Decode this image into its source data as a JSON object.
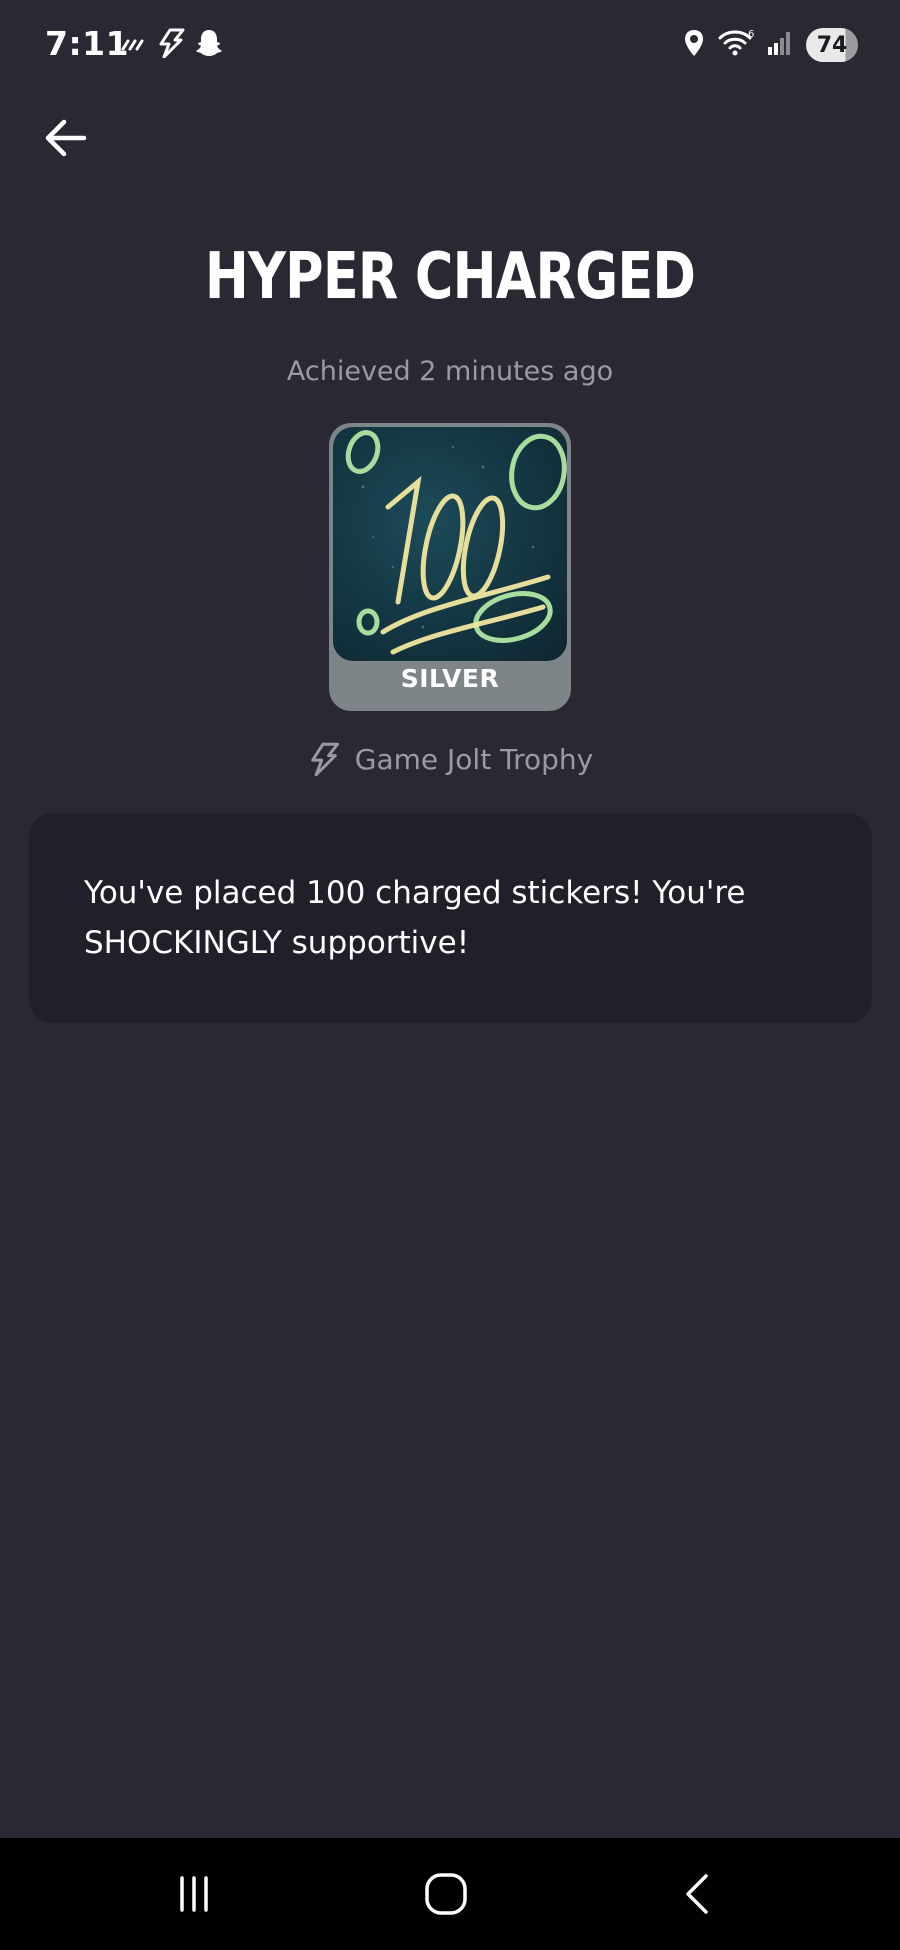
{
  "status_bar": {
    "time": "7:11",
    "battery": "74",
    "icons": [
      "signal-bars-icon",
      "game-jolt-icon",
      "snapchat-icon",
      "location-icon",
      "wifi-icon",
      "cell-signal-icon",
      "battery-icon"
    ]
  },
  "header": {
    "back_icon": "back-arrow-icon"
  },
  "trophy": {
    "title": "HYPER CHARGED",
    "achieved": "Achieved 2 minutes ago",
    "tier": "SILVER",
    "image_text": "100",
    "source_icon": "game-jolt-icon",
    "source": "Game Jolt Trophy",
    "description": "You've placed 100 charged stickers! You're SHOCKINGLY supportive!"
  },
  "nav_bar": {
    "icons": [
      "recent-apps-icon",
      "home-icon",
      "nav-back-icon"
    ]
  },
  "colors": {
    "background": "#292833",
    "card": "#201f2a",
    "muted_text": "#9b9aa4",
    "silver": "#7d8589"
  }
}
